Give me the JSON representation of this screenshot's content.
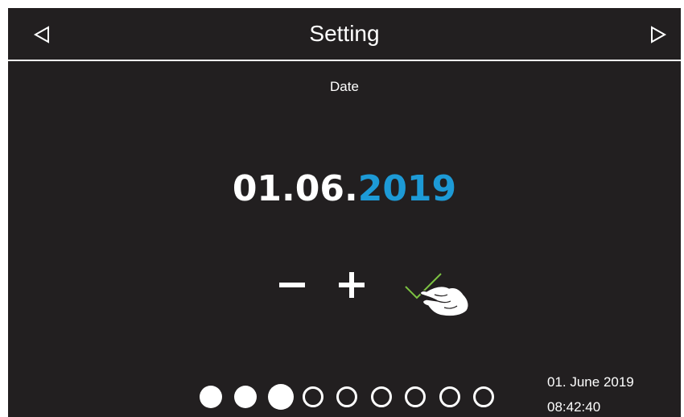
{
  "header": {
    "title": "Setting",
    "back_icon": "triangle-left-outline-icon",
    "forward_icon": "triangle-right-outline-icon"
  },
  "field": {
    "label": "Date",
    "value_fixed": "01.06.",
    "value_active": "2019"
  },
  "controls": {
    "decrement_icon": "minus-icon",
    "increment_icon": "plus-icon",
    "confirm_icon": "tap-confirm-check-icon"
  },
  "pager": {
    "total_pages": 9,
    "dots": [
      "filled",
      "filled",
      "filled-active",
      "empty",
      "empty",
      "empty",
      "empty",
      "empty",
      "empty"
    ]
  },
  "status": {
    "date": "01. June 2019",
    "time": "08:42:40"
  },
  "colors": {
    "background": "#221f20",
    "text": "#ffffff",
    "accent": "#1d9ad6",
    "confirm_check": "#7cc242"
  }
}
